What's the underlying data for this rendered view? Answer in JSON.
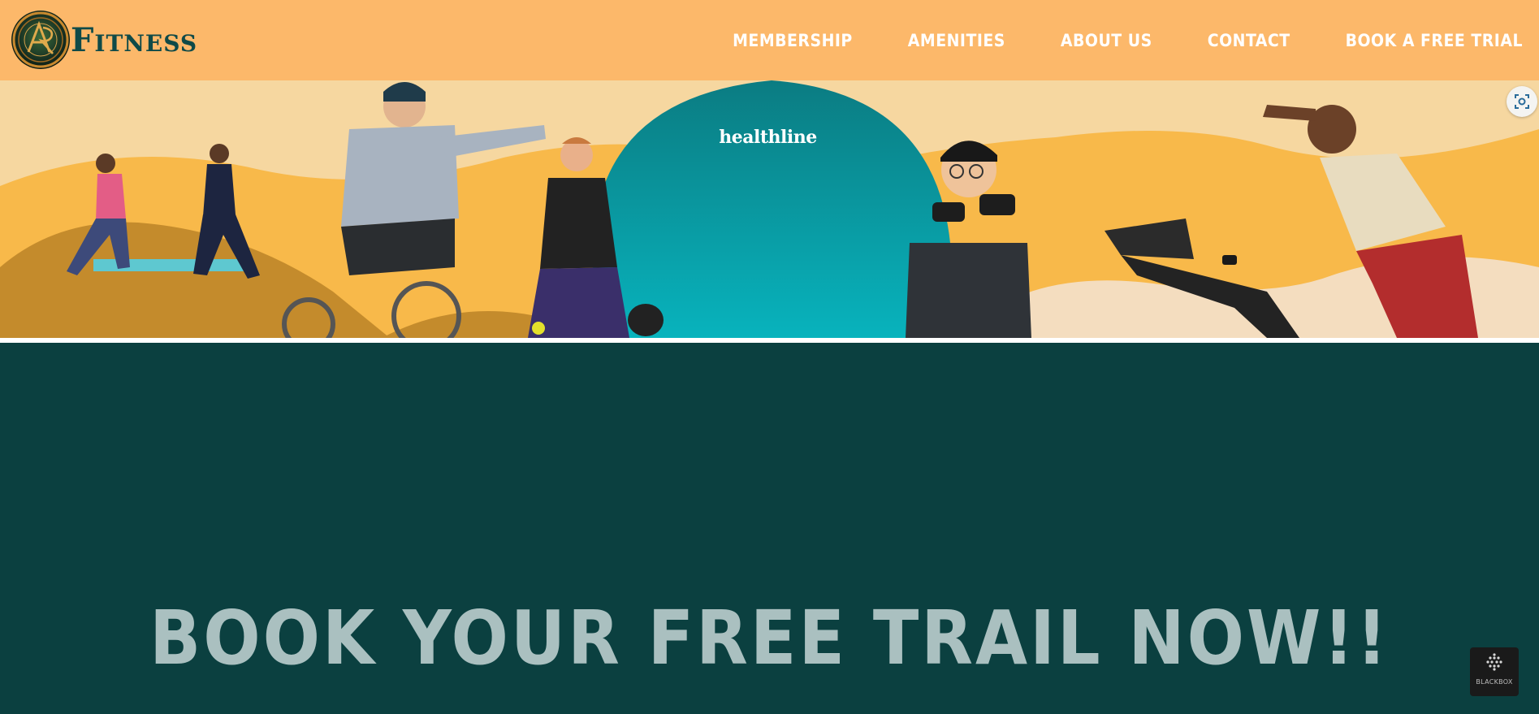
{
  "brand": {
    "logo_monogram": "AR",
    "logo_text": "Fitness"
  },
  "nav": {
    "items": [
      {
        "label": "MEMBERSHIP"
      },
      {
        "label": "AMENITIES"
      },
      {
        "label": "ABOUT US"
      },
      {
        "label": "CONTACT"
      },
      {
        "label": "BOOK A FREE TRIAL"
      }
    ]
  },
  "hero": {
    "brand_text": "healthline",
    "lens_icon": "visual-search-icon"
  },
  "main": {
    "heading": "BOOK YOUR FREE TRAIL NOW!!"
  },
  "badge": {
    "label": "BLACKBOX"
  },
  "colors": {
    "header_bg": "#fcb86a",
    "nav_text": "#ffffff",
    "logo_text": "#0f4a48",
    "main_bg": "#0b4040",
    "heading_text": "#aac0c0",
    "hero_teal": "#0a9fa8"
  }
}
